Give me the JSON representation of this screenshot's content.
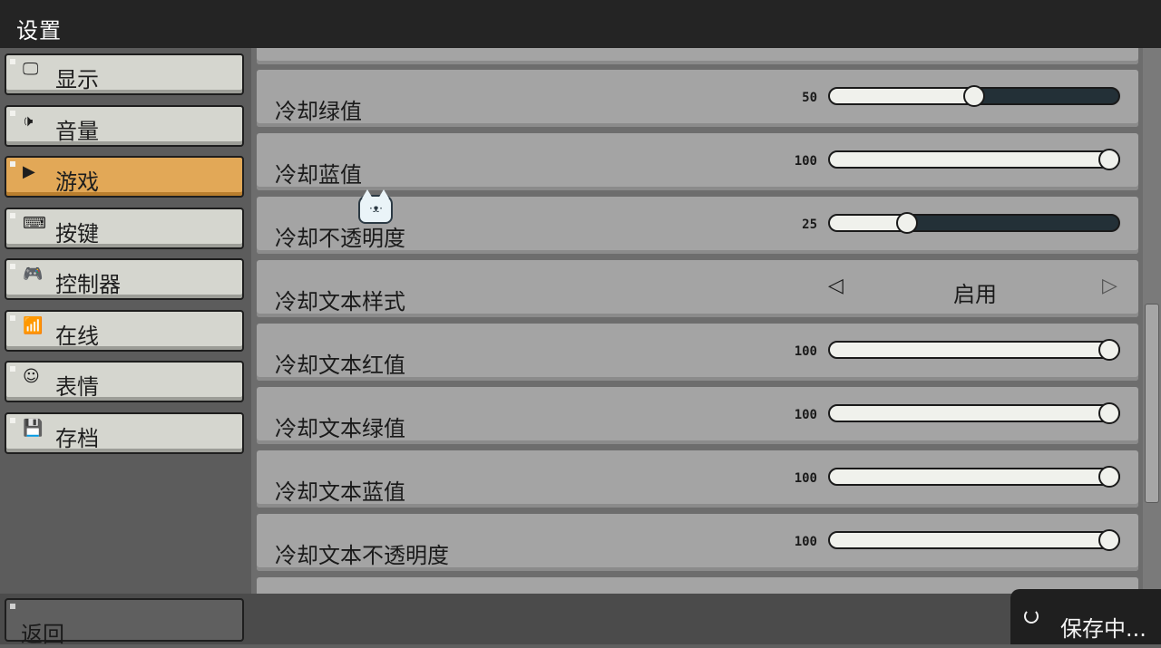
{
  "window": {
    "title": "设置"
  },
  "sidebar": {
    "items": [
      {
        "icon": "monitor-icon",
        "glyph": "🖵",
        "label": "显示",
        "active": false
      },
      {
        "icon": "speaker-icon",
        "glyph": "🕩",
        "label": "音量",
        "active": false
      },
      {
        "icon": "play-icon",
        "glyph": "▶",
        "label": "游戏",
        "active": true
      },
      {
        "icon": "keyboard-icon",
        "glyph": "⌨",
        "label": "按键",
        "active": false
      },
      {
        "icon": "gamepad-icon",
        "glyph": "🎮",
        "label": "控制器",
        "active": false
      },
      {
        "icon": "wifi-icon",
        "glyph": "📶",
        "label": "在线",
        "active": false
      },
      {
        "icon": "emoji-icon",
        "glyph": "☺",
        "label": "表情",
        "active": false
      },
      {
        "icon": "save-icon",
        "glyph": "💾",
        "label": "存档",
        "active": false
      }
    ],
    "back_label": "返回"
  },
  "settings": {
    "rows": [
      {
        "label": "冷却绿值",
        "type": "slider",
        "value": 50,
        "max": 100
      },
      {
        "label": "冷却蓝值",
        "type": "slider",
        "value": 100,
        "max": 100
      },
      {
        "label": "冷却不透明度",
        "type": "slider",
        "value": 25,
        "max": 100
      },
      {
        "label": "冷却文本样式",
        "type": "selector",
        "value": "启用"
      },
      {
        "label": "冷却文本红值",
        "type": "slider",
        "value": 100,
        "max": 100
      },
      {
        "label": "冷却文本绿值",
        "type": "slider",
        "value": 100,
        "max": 100
      },
      {
        "label": "冷却文本蓝值",
        "type": "slider",
        "value": 100,
        "max": 100
      },
      {
        "label": "冷却文本不透明度",
        "type": "slider",
        "value": 100,
        "max": 100
      }
    ]
  },
  "status": {
    "saving_text": "保存中..."
  },
  "colors": {
    "accent": "#e2a857",
    "slider_track": "#233037",
    "topbar": "#242424"
  }
}
